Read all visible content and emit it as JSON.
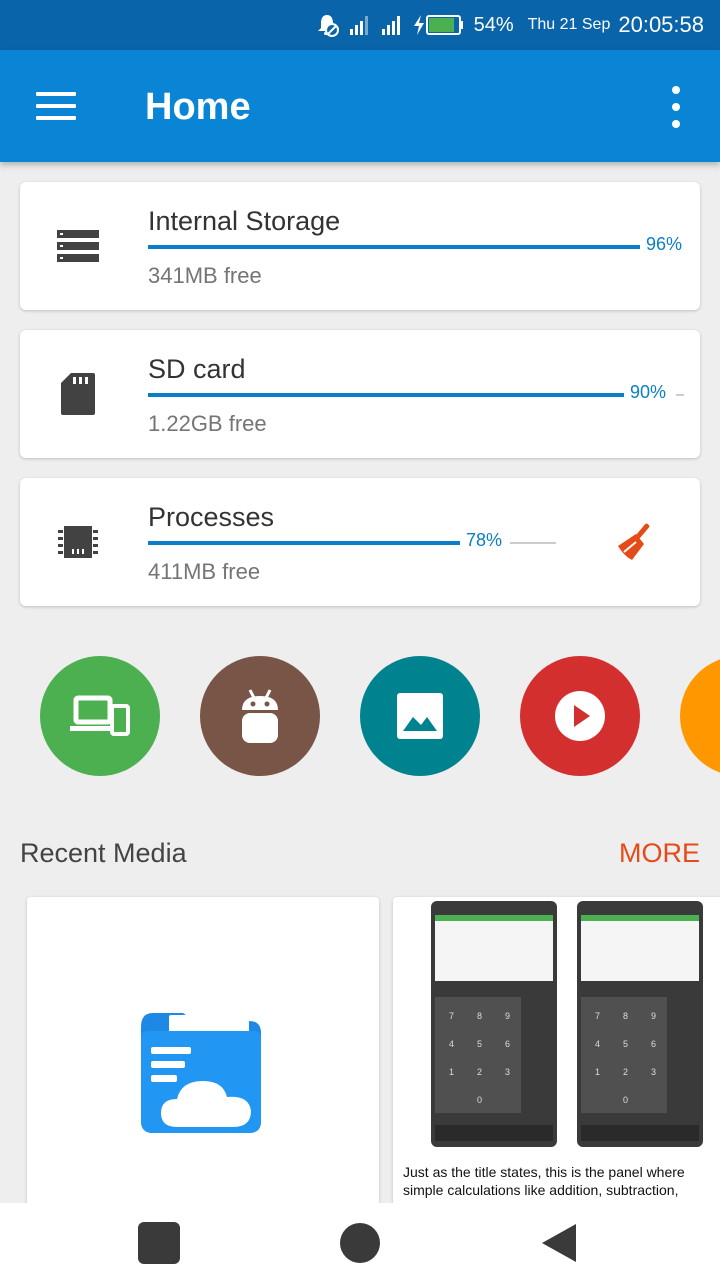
{
  "status_bar": {
    "battery_pct": "54%",
    "date": "Thu 21 Sep",
    "time": "20:05:58",
    "battery_level": 0.54
  },
  "app_bar": {
    "title": "Home",
    "menu_icon": "hamburger-menu-icon",
    "overflow_icon": "more-vert-icon"
  },
  "storage_cards": [
    {
      "title": "Internal Storage",
      "percent": "96%",
      "free": "341MB free",
      "icon": "storage-icon",
      "fraction": 0.96
    },
    {
      "title": "SD card",
      "percent": "90%",
      "free": "1.22GB free",
      "icon": "sd-card-icon",
      "fraction": 0.9
    },
    {
      "title": "Processes",
      "percent": "78%",
      "free": "411MB free",
      "icon": "memory-chip-icon",
      "fraction": 0.78
    }
  ],
  "shortcuts": [
    {
      "name": "devices",
      "icon": "devices-icon",
      "color": "#4caf50"
    },
    {
      "name": "apps",
      "icon": "android-icon",
      "color": "#795548"
    },
    {
      "name": "images",
      "icon": "image-icon",
      "color": "#00838f"
    },
    {
      "name": "videos",
      "icon": "play-icon",
      "color": "#d32f2f"
    },
    {
      "name": "more",
      "icon": "document-icon",
      "color": "#ff9800"
    }
  ],
  "recent_media": {
    "title": "Recent Media",
    "more_label": "MORE",
    "items": [
      {
        "type": "app-logo",
        "icon": "cloud-folder-icon"
      },
      {
        "type": "screenshot",
        "caption_line1": "Just as the title states, this is the panel where",
        "caption_line2": "simple calculations like addition, subtraction,"
      }
    ]
  },
  "colors": {
    "status_bar": "#0a64aa",
    "app_bar": "#0a85d6",
    "accent_progress": "#0a7ec8",
    "more_link": "#e64a19",
    "cleaner_icon": "#e64a19"
  }
}
